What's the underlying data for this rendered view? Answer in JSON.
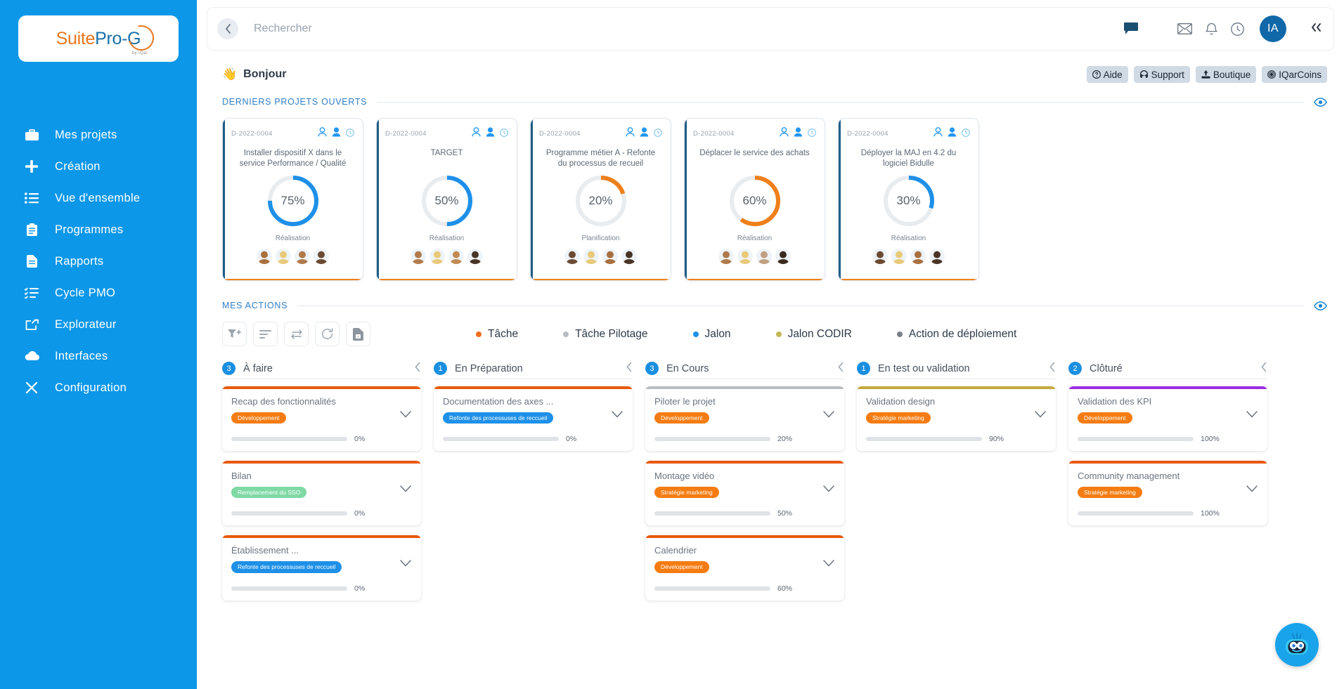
{
  "sidebar": {
    "logo": {
      "part1": "Suite",
      "part2": "Pro-G",
      "tagline": "by IQar"
    },
    "items": [
      {
        "label": "Mes projets",
        "icon": "briefcase-icon"
      },
      {
        "label": "Création",
        "icon": "plus-icon"
      },
      {
        "label": "Vue d'ensemble",
        "icon": "list-icon"
      },
      {
        "label": "Programmes",
        "icon": "clipboard-icon"
      },
      {
        "label": "Rapports",
        "icon": "document-icon"
      },
      {
        "label": "Cycle PMO",
        "icon": "checklist-icon"
      },
      {
        "label": "Explorateur",
        "icon": "share-icon"
      },
      {
        "label": "Interfaces",
        "icon": "cloud-icon"
      },
      {
        "label": "Configuration",
        "icon": "tools-icon"
      }
    ]
  },
  "header": {
    "back_icon": "chevron-left-icon",
    "search_placeholder": "Rechercher",
    "search_value": "",
    "icons": [
      "chat-icon",
      "apps-grid-icon",
      "mail-icon",
      "bell-icon",
      "clock-icon"
    ],
    "avatar_initials": "IA",
    "collapse_icon": "double-chevron-left-icon"
  },
  "greeting": {
    "wave": "👋",
    "text": "Bonjour",
    "actions": [
      {
        "label": "Aide",
        "icon": "question-circle-icon"
      },
      {
        "label": "Support",
        "icon": "support-headset-icon"
      },
      {
        "label": "Boutique",
        "icon": "upload-store-icon"
      },
      {
        "label": "IQarCoins",
        "icon": "coin-icon"
      }
    ]
  },
  "sections": {
    "projects_title": "DERNIERS PROJETS OUVERTS",
    "actions_title": "MES ACTIONS",
    "eye_icon": "eye-icon"
  },
  "projects": [
    {
      "id": "D-2022-0004",
      "title": "Installer dispositif X dans le service Performance / Qualité",
      "percent": 75,
      "percent_label": "75%",
      "phase": "Réalisation",
      "ring_color": "#1e90e8",
      "avatars": [
        "#a8703e",
        "#e9c97a",
        "#b07a4a",
        "#6b4a33"
      ]
    },
    {
      "id": "D-2022-0004",
      "title": "TARGET",
      "percent": 50,
      "percent_label": "50%",
      "phase": "Réalisation",
      "ring_color": "#1e90e8",
      "avatars": [
        "#b07a4a",
        "#e9c97a",
        "#c08a52",
        "#4a3426"
      ]
    },
    {
      "id": "D-2022-0004",
      "title": "Programme métier A - Refonte du processus de recueil",
      "percent": 20,
      "percent_label": "20%",
      "phase": "Planification",
      "ring_color": "#ef7f1a",
      "avatars": [
        "#6b4a33",
        "#e9c97a",
        "#a8703e",
        "#4a3426"
      ]
    },
    {
      "id": "D-2022-0004",
      "title": "Déplacer le service des achats",
      "percent": 60,
      "percent_label": "60%",
      "phase": "Réalisation",
      "ring_color": "#ef7f1a",
      "avatars": [
        "#b07a4a",
        "#e9c97a",
        "#c0a080",
        "#3a2a1e"
      ]
    },
    {
      "id": "D-2022-0004",
      "title": "Déployer la MAJ en 4.2 du logiciel Bidulle",
      "percent": 30,
      "percent_label": "30%",
      "phase": "Réalisation",
      "ring_color": "#1e90e8",
      "avatars": [
        "#6b4a33",
        "#e9c97a",
        "#a8703e",
        "#4a3426"
      ]
    }
  ],
  "toolbar": [
    {
      "icon": "filter-add-icon",
      "name": "add-filter-button"
    },
    {
      "icon": "sort-lines-icon",
      "name": "sort-button"
    },
    {
      "icon": "swap-arrows-icon",
      "name": "swap-button"
    },
    {
      "icon": "refresh-icon",
      "name": "refresh-button"
    },
    {
      "icon": "excel-export-icon",
      "name": "export-excel-button"
    }
  ],
  "legend": [
    {
      "label": "Tâche",
      "color": "#ef6c1a"
    },
    {
      "label": "Tâche Pilotage",
      "color": "#b9bcc0"
    },
    {
      "label": "Jalon",
      "color": "#1e90e8"
    },
    {
      "label": "Jalon CODIR",
      "color": "#c4b757"
    },
    {
      "label": "Action de déploiement",
      "color": "#7a7f87"
    }
  ],
  "kanban": [
    {
      "name": "À faire",
      "count": "3",
      "collapse_icon": "chevron-left-icon",
      "cards": [
        {
          "title": "Recap des fonctionnalités",
          "bar": "#e8590c",
          "chip": "Développement",
          "chip_color": "#f57c12",
          "progress": 0,
          "progress_label": "0%",
          "progress_color": "#dfe3e8"
        },
        {
          "title": "Bilan",
          "bar": "#e8590c",
          "chip": "Remplacement du SSO",
          "chip_color": "#7fd9a4",
          "progress": 0,
          "progress_label": "0%",
          "progress_color": "#dfe3e8"
        },
        {
          "title": "Établissement ...",
          "bar": "#e8590c",
          "chip": "Refonte des processuses de reccueil",
          "chip_color": "#1e90e8",
          "progress": 0,
          "progress_label": "0%",
          "progress_color": "#dfe3e8"
        }
      ]
    },
    {
      "name": "En Préparation",
      "count": "1",
      "collapse_icon": "chevron-left-icon",
      "cards": [
        {
          "title": "Documentation des axes ...",
          "bar": "#e8590c",
          "chip": "Refonte des processuses de reccueil",
          "chip_color": "#1e90e8",
          "progress": 0,
          "progress_label": "0%",
          "progress_color": "#dfe3e8"
        }
      ]
    },
    {
      "name": "En Cours",
      "count": "3",
      "collapse_icon": "chevron-left-icon",
      "cards": [
        {
          "title": "Piloter le projet",
          "bar": "#b9bcc0",
          "chip": "Développement",
          "chip_color": "#f57c12",
          "progress": 20,
          "progress_label": "20%",
          "progress_color": "#e8616b"
        },
        {
          "title": "Montage vidéo",
          "bar": "#e8590c",
          "chip": "Stratégie marketing",
          "chip_color": "#f57c12",
          "progress": 50,
          "progress_label": "50%",
          "progress_color": "#1f9d4e"
        },
        {
          "title": "Calendrier",
          "bar": "#e8590c",
          "chip": "Développement",
          "chip_color": "#f57c12",
          "progress": 60,
          "progress_label": "60%",
          "progress_color": "#1f9d4e"
        }
      ]
    },
    {
      "name": "En test ou validation",
      "count": "1",
      "collapse_icon": "chevron-left-icon",
      "cards": [
        {
          "title": "Validation design",
          "bar": "#c4a83b",
          "chip": "Stratégie marketing",
          "chip_color": "#f57c12",
          "progress": 90,
          "progress_label": "90%",
          "progress_color": "#1f9d4e"
        }
      ]
    },
    {
      "name": "Clôturé",
      "count": "2",
      "collapse_icon": "chevron-left-icon",
      "cards": [
        {
          "title": "Validation des KPI",
          "bar": "#9b2fe0",
          "chip": "Développement",
          "chip_color": "#f57c12",
          "progress": 100,
          "progress_label": "100%",
          "progress_color": "#1f9d4e"
        },
        {
          "title": "Community management",
          "bar": "#e8590c",
          "chip": "Stratégie marketing",
          "chip_color": "#f57c12",
          "progress": 100,
          "progress_label": "100%",
          "progress_color": "#1f9d4e"
        }
      ]
    }
  ],
  "chatbot": {
    "icon": "robot-assistant-icon"
  },
  "colors": {
    "sidebar_bg": "#0d97e8",
    "accent_blue": "#1a84d8",
    "accent_orange": "#ef7f1a"
  }
}
